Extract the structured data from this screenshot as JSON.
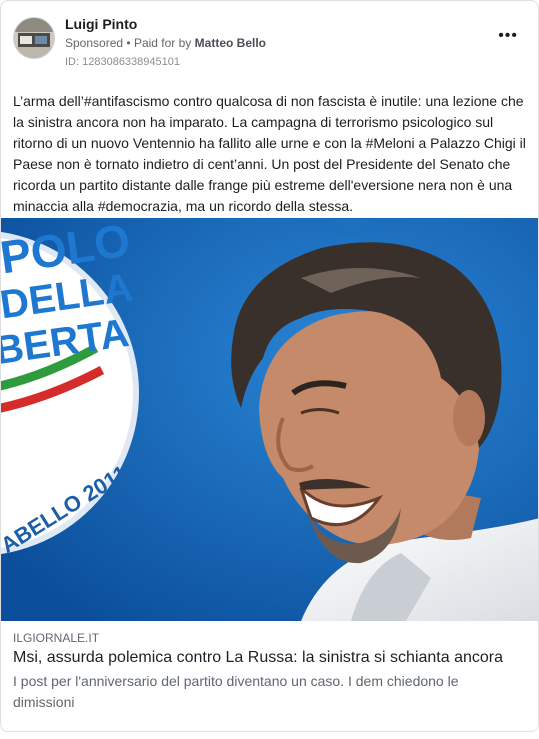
{
  "post": {
    "author": "Luigi Pinto",
    "sponsored_label": "Sponsored",
    "separator": "•",
    "paid_for_prefix": "Paid for by",
    "paid_for_name": "Matteo Bello",
    "ad_id": "ID: 1283086338945101",
    "more_icon": "more-horizontal-icon",
    "more_label": "•••",
    "text": "L’arma dell’#antifascismo contro qualcosa di non fascista è inutile: una lezione che la sinistra ancora non ha imparato. La campagna di terrorismo psicologico sul ritorno di un nuovo Ventennio ha fallito alle urne e con la #Meloni a Palazzo Chigi il Paese non è tornato indietro di cent’anni. Un post del Presidente del Senato che ricorda un partito distante dalle frange più estreme dell'eversione nera non è una minaccia alla #democrazia, ma un ricordo della stessa."
  },
  "photo": {
    "logo_line1": "POLO",
    "logo_line2": "DELLA",
    "logo_line3": "BERTA",
    "logo_arc": "ABELLO 2011"
  },
  "link": {
    "domain": "ILGIORNALE.IT",
    "headline": "Msi, assurda polemica contro La Russa: la sinistra si schianta ancora",
    "description": "I post per l'anniversario del partito diventano un caso. I dem chiedono le dimissioni"
  },
  "colors": {
    "bg_blue": "#0d63b8",
    "accent_blue": "#1877f2",
    "flag_green": "#2e9b3d",
    "flag_red": "#d52b2b"
  }
}
